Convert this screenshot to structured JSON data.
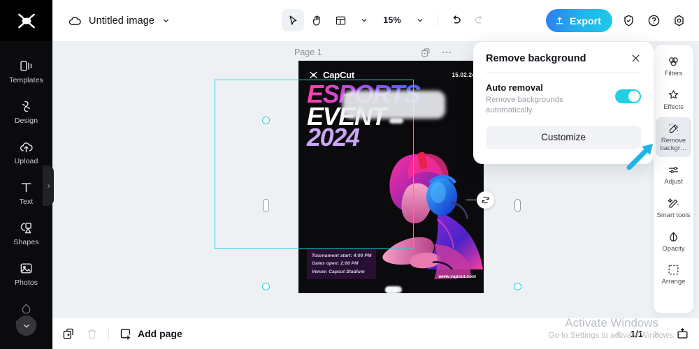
{
  "app": {
    "logo_icon": "capcut-logo-icon",
    "doc_title": "Untitled image",
    "cloud_icon": "cloud-sync-icon",
    "title_chevron_icon": "chevron-down-icon"
  },
  "toolbar": {
    "select_icon": "cursor-select-icon",
    "hand_icon": "hand-pan-icon",
    "layout_icon": "layout-grid-icon",
    "layout_chevron_icon": "chevron-down-icon",
    "zoom_value": "15%",
    "zoom_chevron_icon": "chevron-down-icon",
    "undo_icon": "undo-icon",
    "redo_icon": "redo-icon",
    "export_label": "Export",
    "export_icon": "upload-icon",
    "shield_icon": "shield-check-icon",
    "help_icon": "help-circle-icon",
    "settings_icon": "gear-icon",
    "accent_color": "#21b9e8"
  },
  "sidebar_left": {
    "items": [
      {
        "label": "Templates",
        "icon": "templates-icon"
      },
      {
        "label": "Design",
        "icon": "design-icon"
      },
      {
        "label": "Upload",
        "icon": "upload-cloud-icon"
      },
      {
        "label": "Text",
        "icon": "text-icon"
      },
      {
        "label": "Shapes",
        "icon": "shapes-icon"
      },
      {
        "label": "Photos",
        "icon": "photos-icon"
      },
      {
        "label": "Colors",
        "icon": "color-drop-icon"
      }
    ],
    "collapse_icon": "chevron-right-icon",
    "more_icon": "chevron-down-icon"
  },
  "canvas": {
    "page_label": "Page 1",
    "duplicate_icon": "duplicate-page-icon",
    "more_icon": "more-horizontal-icon",
    "rotate_icon": "rotate-icon",
    "poster": {
      "brand": "CapCut",
      "brand_icon": "capcut-logo-icon",
      "date": "15.02.24",
      "heading_line1": "ESPORTS",
      "heading_line2": "EVENT",
      "heading_line3": "2024",
      "info_line1": "Tournament start: 4:00 PM",
      "info_line2": "Gates open: 2:00 PM",
      "info_line3": "Venue: Capcut Stadium",
      "url": "www.capcut.com"
    }
  },
  "remove_background_panel": {
    "title": "Remove background",
    "close_icon": "close-icon",
    "option_title": "Auto removal",
    "option_desc": "Remove backgrounds automatically.",
    "toggle_state": "on",
    "toggle_color": "#21cfe3",
    "customize_label": "Customize"
  },
  "sidebar_right": {
    "items": [
      {
        "label": "Filters",
        "icon": "filters-icon",
        "selected": false
      },
      {
        "label": "Effects",
        "icon": "effects-sparkle-icon",
        "selected": false
      },
      {
        "label": "Remove backgr…",
        "icon": "remove-background-icon",
        "selected": true
      },
      {
        "label": "Adjust",
        "icon": "adjust-sliders-icon",
        "selected": false
      },
      {
        "label": "Smart tools",
        "icon": "magic-wand-icon",
        "selected": false
      },
      {
        "label": "Opacity",
        "icon": "opacity-drop-icon",
        "selected": false
      },
      {
        "label": "Arrange",
        "icon": "arrange-icon",
        "selected": false
      }
    ],
    "annotation_arrow_icon": "arrow-pointer-annotation-icon",
    "annotation_color": "#21b9e8"
  },
  "bottom_bar": {
    "duplicate_icon": "duplicate-page-icon",
    "delete_icon": "trash-icon",
    "add_page_label": "Add page",
    "add_page_icon": "add-page-icon",
    "prev_icon": "chevron-left-icon",
    "page_indicator": "1/1",
    "next_icon": "chevron-right-icon",
    "present_icon": "present-screen-icon"
  },
  "watermark": {
    "line1": "Activate Windows",
    "line2": "Go to Settings to activate Windows."
  }
}
